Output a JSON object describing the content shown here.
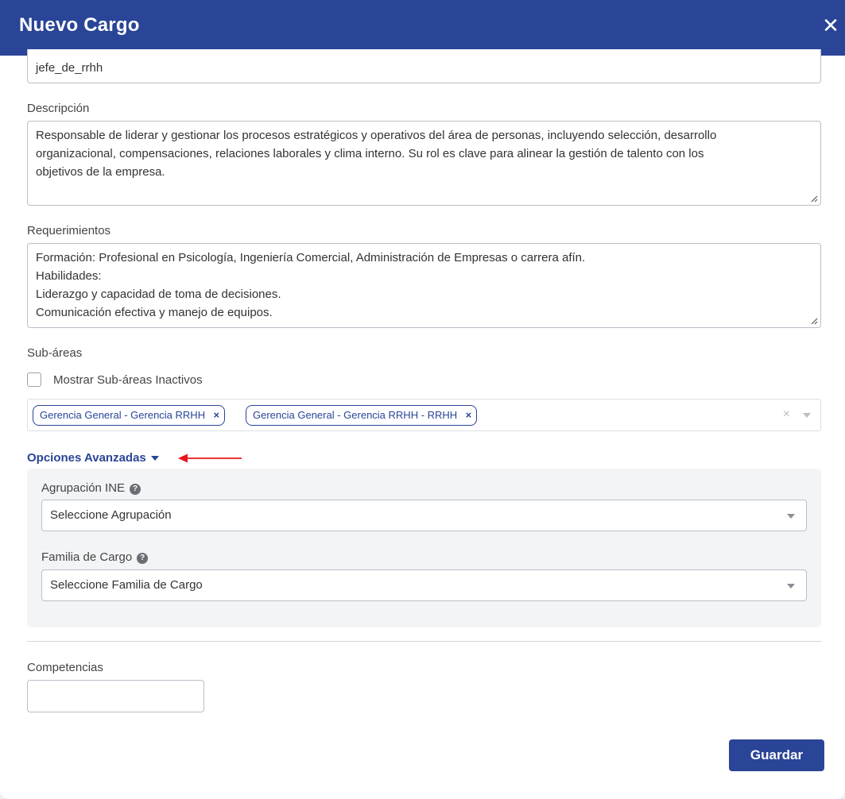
{
  "modal": {
    "title": "Nuevo Cargo",
    "close_label": "✕"
  },
  "fields": {
    "code_value": "jefe_de_rrhh",
    "descripcion_label": "Descripción",
    "descripcion_lines": [
      "Responsable de liderar y gestionar los procesos estratégicos y operativos del área de personas, incluyendo selección, desarrollo",
      "organizacional, compensaciones, relaciones laborales y clima interno. Su rol es clave para alinear la gestión de talento con los",
      "objetivos de la empresa."
    ],
    "requerimientos_label": "Requerimientos",
    "requerimientos_lines": [
      "Formación: Profesional en Psicología, Ingeniería Comercial, Administración de Empresas o carrera afín.",
      "Habilidades:",
      "Liderazgo y capacidad de toma de decisiones.",
      "Comunicación efectiva y manejo de equipos."
    ],
    "subareas_label": "Sub-áreas",
    "show_inactive_label": "Mostrar Sub-áreas Inactivos",
    "show_inactive_checked": false,
    "subarea_tags": [
      "Gerencia General - Gerencia RRHH",
      "Gerencia General - Gerencia RRHH - RRHH"
    ],
    "tag_remove": "×",
    "clear_symbol": "×"
  },
  "advanced": {
    "toggle_label": "Opciones Avanzadas",
    "agrupacion_label": "Agrupación INE",
    "agrupacion_placeholder": "Seleccione Agrupación",
    "familia_label": "Familia de Cargo",
    "familia_placeholder": "Seleccione Familia de Cargo",
    "help_symbol": "?"
  },
  "competencias": {
    "label": "Competencias",
    "value": ""
  },
  "actions": {
    "save_label": "Guardar"
  },
  "colors": {
    "primary": "#2a4597",
    "annotation_arrow": "#e8141b"
  }
}
